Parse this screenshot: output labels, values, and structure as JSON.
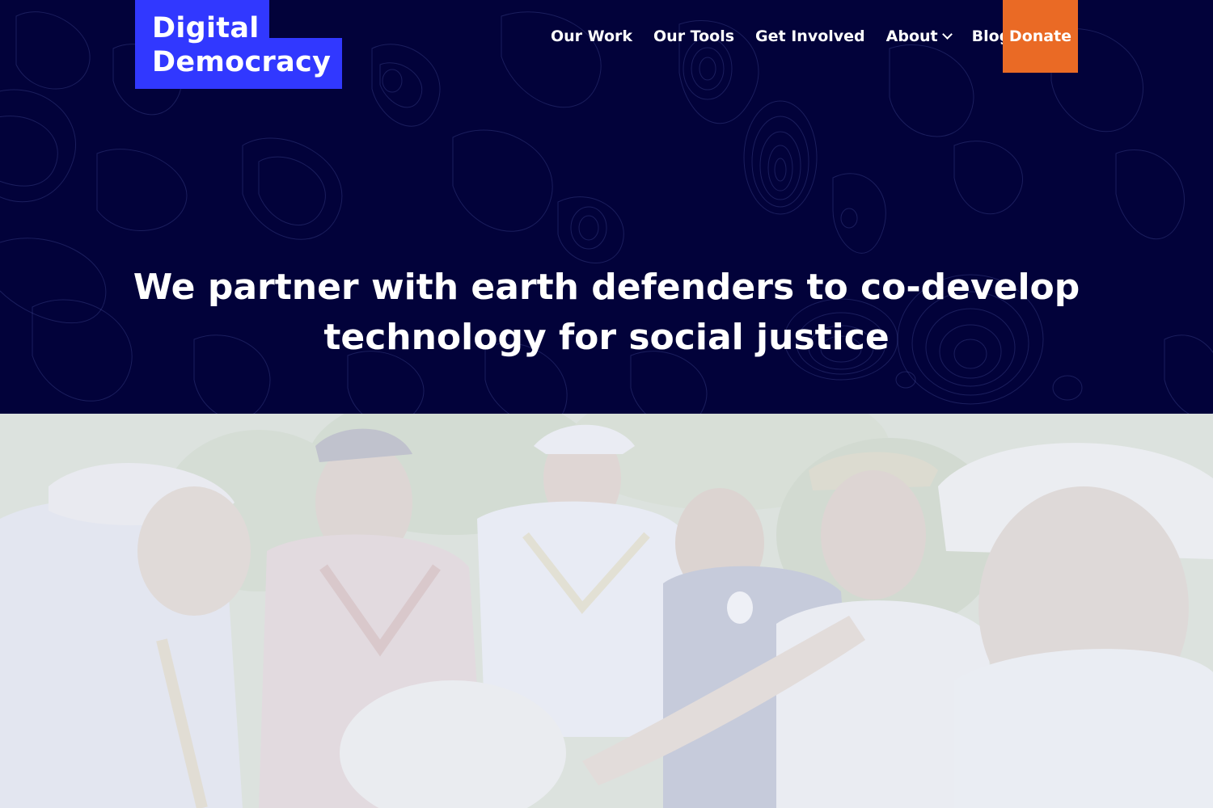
{
  "brand": {
    "logo_line1": "Digital",
    "logo_line2": "Democracy",
    "logo_color": "#3138ff"
  },
  "nav": {
    "items": [
      {
        "label": "Our Work"
      },
      {
        "label": "Our Tools"
      },
      {
        "label": "Get Involved"
      },
      {
        "label": "About",
        "has_dropdown": true,
        "dropdown_icon": "chevron-down-icon"
      },
      {
        "label": "Blog"
      }
    ],
    "donate_label": "Donate",
    "donate_color": "#ea6a25"
  },
  "hero": {
    "headline": "We partner with earth defenders to co-develop technology for social justice",
    "background_color": "#02023a"
  }
}
